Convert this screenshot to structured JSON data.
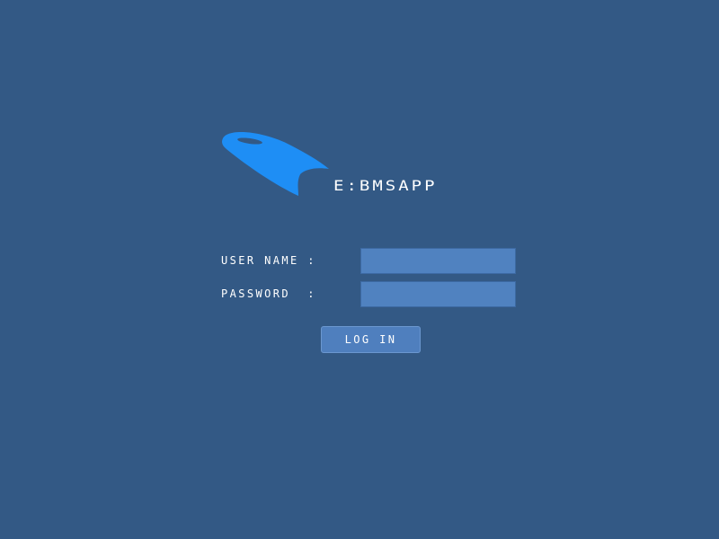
{
  "brand": {
    "name": "E:BMSAPP",
    "logo_icon": "swoosh-logo-icon",
    "logo_color": "#1e8ef5"
  },
  "colors": {
    "background": "#335985",
    "input_background": "#5082c0",
    "button_background": "#4f7fbe"
  },
  "form": {
    "username_label": "USER NAME :",
    "username_value": "",
    "password_label": "PASSWORD  :",
    "password_value": "",
    "login_label": "LOG IN"
  }
}
